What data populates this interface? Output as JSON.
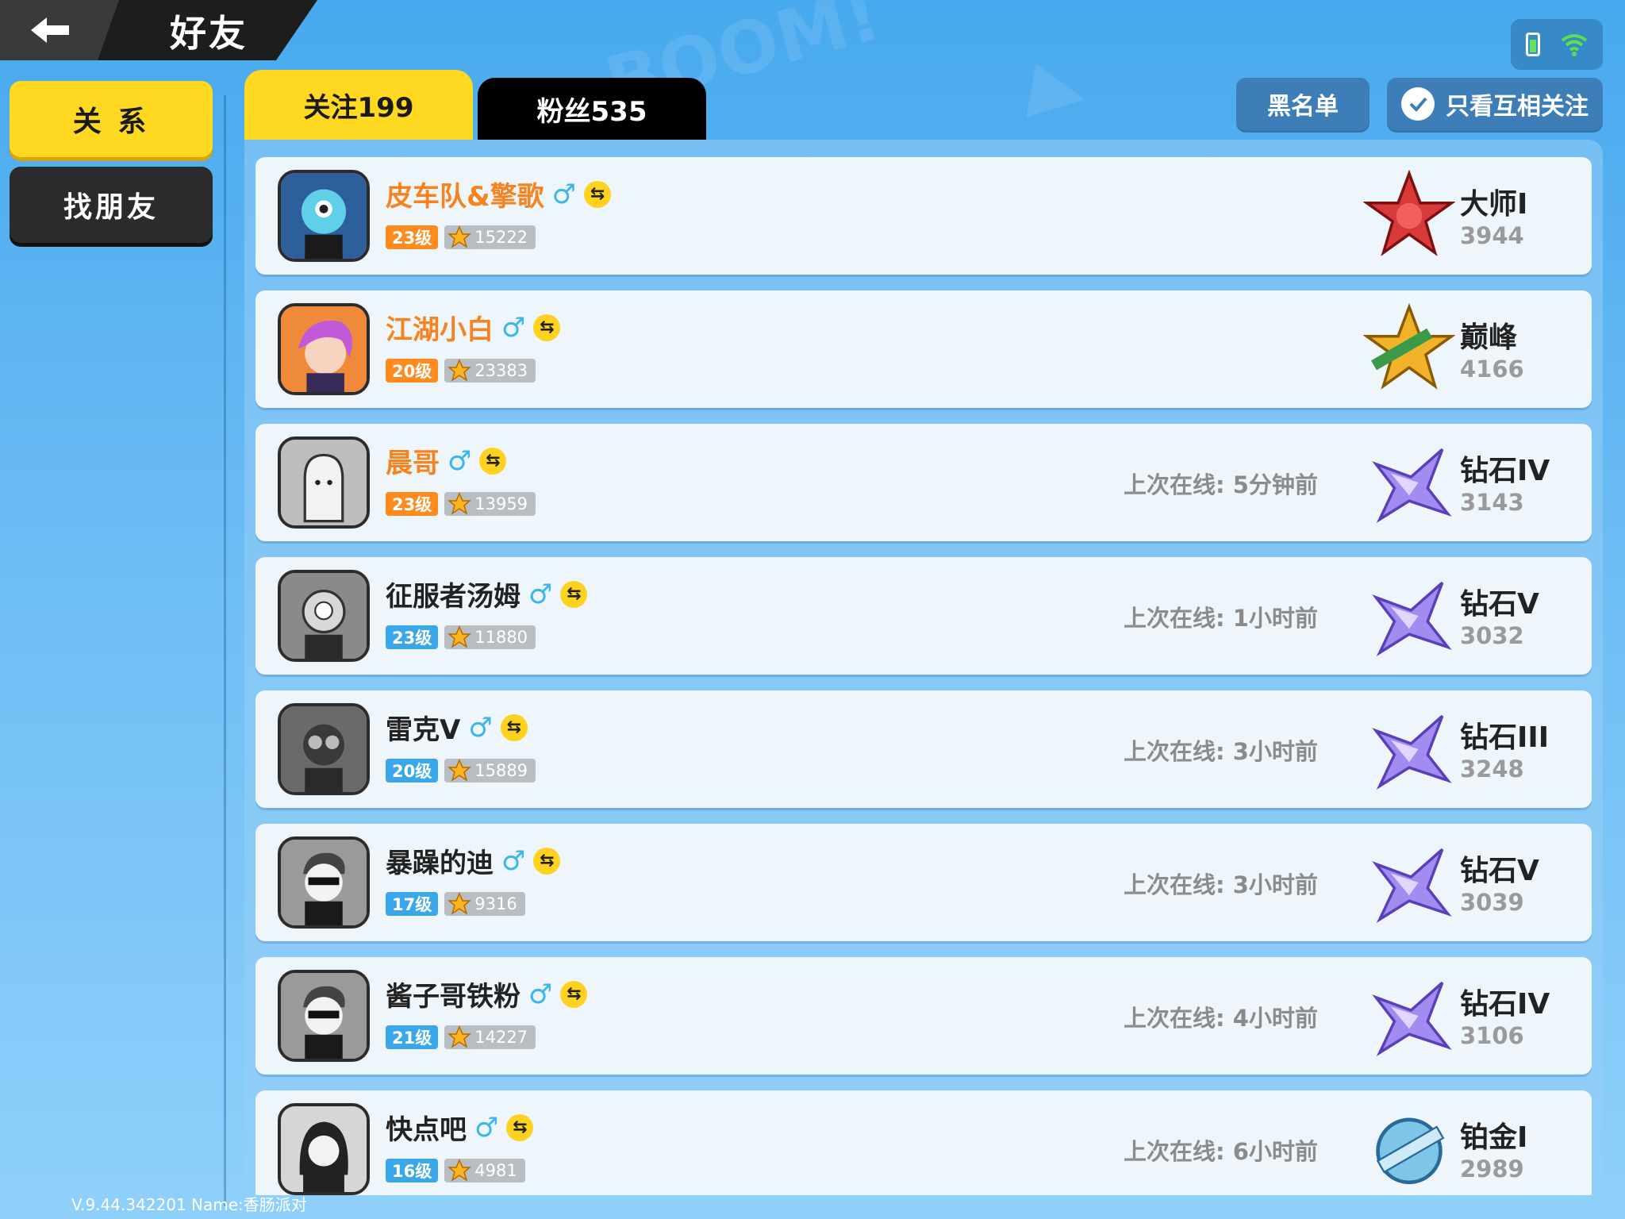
{
  "header": {
    "title": "好友"
  },
  "nav": {
    "relations": "关 系",
    "find_friends": "找朋友"
  },
  "tabs": {
    "follow": "关注199",
    "fans": "粉丝535"
  },
  "actions": {
    "blacklist": "黑名单",
    "mutual_only": "只看互相关注"
  },
  "friends": [
    {
      "name": "皮车队&擎歌",
      "name_color": "orange",
      "level": "23级",
      "level_color": "orange",
      "score": "15222",
      "last_online": "",
      "rank": "大师I",
      "rank_score": "3944",
      "rank_icon": "master-rank-icon",
      "avatar": "blue-robot-avatar"
    },
    {
      "name": "江湖小白",
      "name_color": "orange",
      "level": "20级",
      "level_color": "orange",
      "score": "23383",
      "last_online": "",
      "rank": "巅峰",
      "rank_score": "4166",
      "rank_icon": "peak-rank-icon",
      "avatar": "purple-hair-avatar"
    },
    {
      "name": "晨哥",
      "name_color": "orange",
      "level": "23级",
      "level_color": "orange",
      "score": "13959",
      "last_online": "上次在线: 5分钟前",
      "rank": "钻石IV",
      "rank_score": "3143",
      "rank_icon": "diamond-rank-icon",
      "avatar": "ghost-avatar"
    },
    {
      "name": "征服者汤姆",
      "name_color": "black",
      "level": "23级",
      "level_color": "blue",
      "score": "11880",
      "last_online": "上次在线: 1小时前",
      "rank": "钻石V",
      "rank_score": "3032",
      "rank_icon": "diamond-rank-icon",
      "avatar": "robot-avatar"
    },
    {
      "name": "雷克V",
      "name_color": "black",
      "level": "20级",
      "level_color": "blue",
      "score": "15889",
      "last_online": "上次在线: 3小时前",
      "rank": "钻石III",
      "rank_score": "3248",
      "rank_icon": "diamond-rank-icon",
      "avatar": "helmet-avatar"
    },
    {
      "name": "暴躁的迪",
      "name_color": "black",
      "level": "17级",
      "level_color": "blue",
      "score": "9316",
      "last_online": "上次在线: 3小时前",
      "rank": "钻石V",
      "rank_score": "3039",
      "rank_icon": "diamond-rank-icon",
      "avatar": "sunglasses-avatar"
    },
    {
      "name": "酱子哥铁粉",
      "name_color": "black",
      "level": "21级",
      "level_color": "blue",
      "score": "14227",
      "last_online": "上次在线: 4小时前",
      "rank": "钻石IV",
      "rank_score": "3106",
      "rank_icon": "diamond-rank-icon",
      "avatar": "sunglasses-avatar"
    },
    {
      "name": "快点吧",
      "name_color": "black",
      "level": "16级",
      "level_color": "blue",
      "score": "4981",
      "last_online": "上次在线: 6小时前",
      "rank": "铂金I",
      "rank_score": "2989",
      "rank_icon": "platinum-rank-icon",
      "avatar": "dark-hair-avatar"
    }
  ],
  "footer": {
    "version": "V.9.44.342201 Name:香肠派对"
  },
  "colors": {
    "accent_yellow": "#ffd821",
    "orange": "#f7831f",
    "blue": "#3aa7ea",
    "background": "#5db3f0"
  }
}
